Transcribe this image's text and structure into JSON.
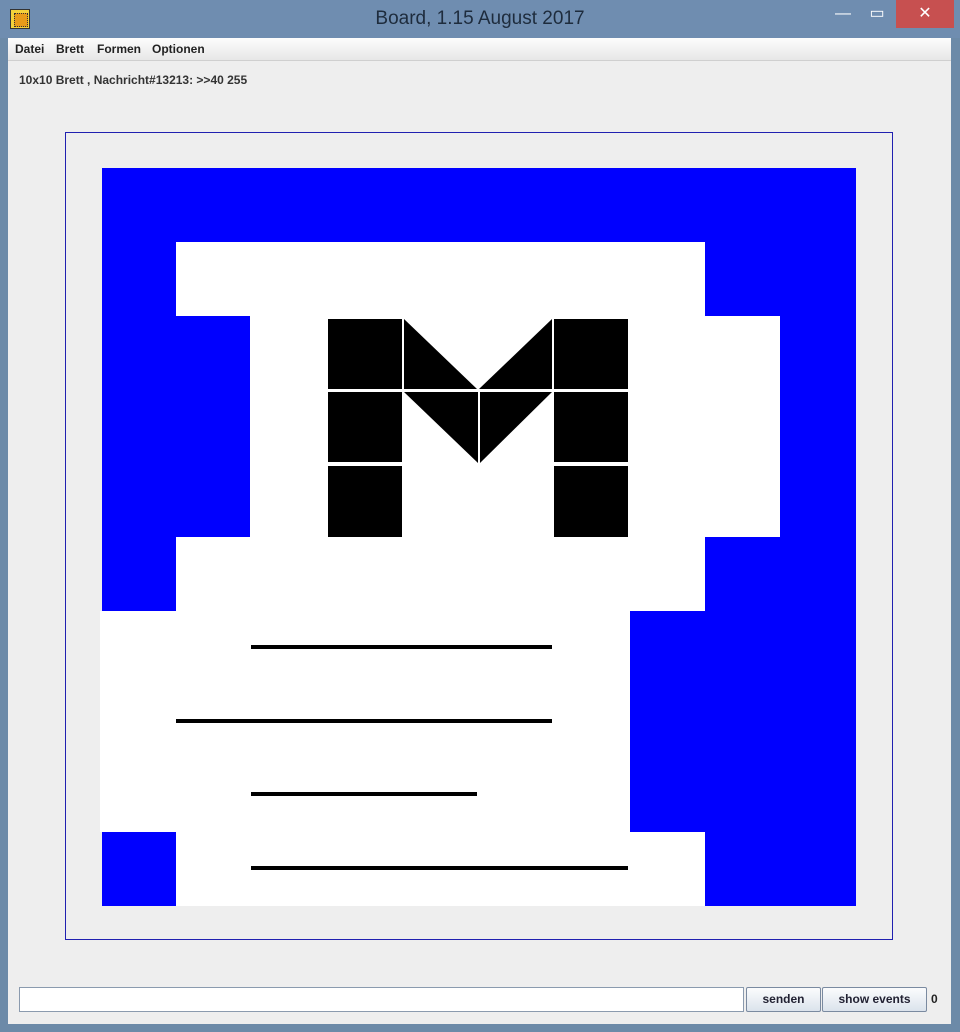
{
  "window": {
    "title": "Board, 1.15 August 2017",
    "controls": {
      "minimize": "—",
      "maximize": "▭",
      "close": "✕"
    }
  },
  "menubar": {
    "items": [
      "Datei",
      "Brett",
      "Formen",
      "Optionen"
    ]
  },
  "status": {
    "text": "10x10 Brett , Nachricht#13213: >>40 255"
  },
  "board": {
    "size": "10x10",
    "colors": {
      "blue": "#0000ff",
      "white": "#ffffff",
      "black": "#000000",
      "frame": "#2020b0"
    },
    "grid": [
      [
        "blue",
        "blue",
        "blue",
        "blue",
        "blue",
        "blue",
        "blue",
        "blue",
        "blue",
        "blue"
      ],
      [
        "blue",
        "white",
        "white",
        "white",
        "white",
        "white",
        "white",
        "white",
        "blue",
        "blue"
      ],
      [
        "blue",
        "blue",
        "white",
        "black",
        "diag-down",
        "diag-up",
        "black",
        "white",
        "white",
        "blue"
      ],
      [
        "blue",
        "blue",
        "white",
        "black",
        "tri-down-left",
        "tri-down-right",
        "black",
        "white",
        "white",
        "blue"
      ],
      [
        "blue",
        "blue",
        "white",
        "black",
        "white",
        "white",
        "black",
        "white",
        "white",
        "blue"
      ],
      [
        "blue",
        "white",
        "white",
        "white",
        "white",
        "white",
        "white",
        "white",
        "blue",
        "blue"
      ],
      [
        "white",
        "white",
        "white",
        "white",
        "white",
        "white",
        "white",
        "blue",
        "blue",
        "blue"
      ],
      [
        "white",
        "white",
        "white",
        "white",
        "white",
        "white",
        "white",
        "blue",
        "blue",
        "blue"
      ],
      [
        "white",
        "white",
        "white",
        "white",
        "white",
        "white",
        "white",
        "blue",
        "blue",
        "blue"
      ],
      [
        "blue",
        "white",
        "white",
        "white",
        "white",
        "white",
        "white",
        "white",
        "blue",
        "blue"
      ]
    ]
  },
  "bottom": {
    "input_value": "",
    "send_label": "senden",
    "events_label": "show events",
    "event_count": "0"
  }
}
